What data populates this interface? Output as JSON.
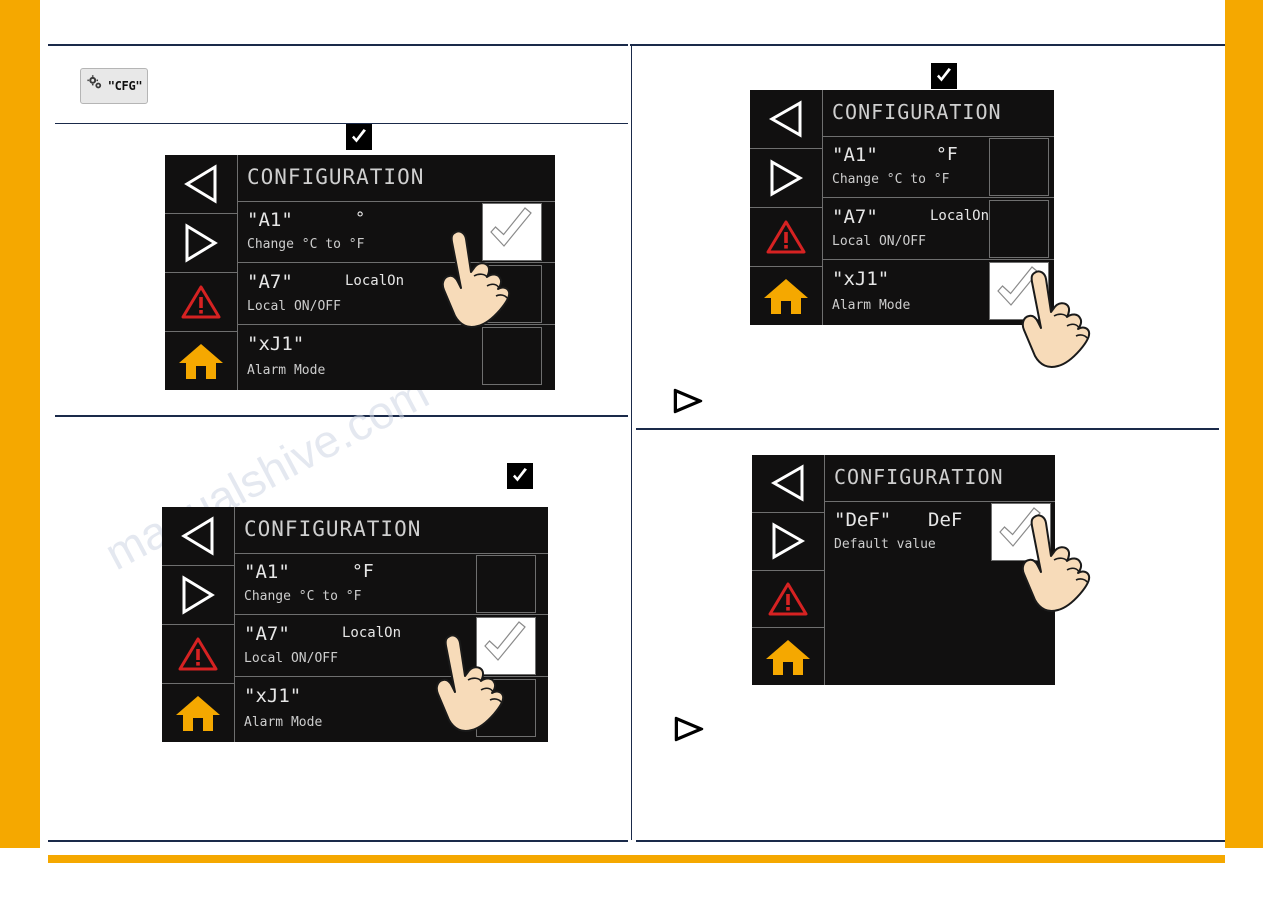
{
  "colors": {
    "accent_orange": "#f5a800",
    "rule_navy": "#1a2a4a",
    "screen_bg": "#111010",
    "screen_text": "#e6e6e6",
    "screen_grid": "#6f6f6f",
    "home_icon": "#f5a800",
    "warning_icon": "#d62222"
  },
  "cfg_button": {
    "label": "\"CFG\"",
    "icon": "gears-icon"
  },
  "watermark": {
    "text": "manualshive.com"
  },
  "panels": {
    "p1": {
      "title": "CONFIGURATION",
      "rows": [
        {
          "code": "\"A1\"",
          "value": "°",
          "desc": "Change °C to °F",
          "box": "checked"
        },
        {
          "code": "\"A7\"",
          "value": "LocalOn",
          "desc": "Local ON/OFF",
          "box": "empty"
        },
        {
          "code": "\"xJ1\"",
          "value": "",
          "desc": "Alarm Mode",
          "box": "empty"
        }
      ],
      "top_icon": "checkbox-checked-icon"
    },
    "p2": {
      "title": "CONFIGURATION",
      "rows": [
        {
          "code": "\"A1\"",
          "value": "°F",
          "desc": "Change °C to °F",
          "box": "empty"
        },
        {
          "code": "\"A7\"",
          "value": "LocalOn",
          "desc": "Local ON/OFF",
          "box": "checked"
        },
        {
          "code": "\"xJ1\"",
          "value": "",
          "desc": "Alarm Mode",
          "box": "empty"
        }
      ],
      "top_icon": "checkbox-checked-icon"
    },
    "p3": {
      "title": "CONFIGURATION",
      "rows": [
        {
          "code": "\"A1\"",
          "value": "°F",
          "desc": "Change °C to °F",
          "box": "empty"
        },
        {
          "code": "\"A7\"",
          "value": "LocalOn",
          "desc": "Local ON/OFF",
          "box": "empty"
        },
        {
          "code": "\"xJ1\"",
          "value": "",
          "desc": "Alarm Mode",
          "box": "checked"
        }
      ],
      "top_icon": "checkbox-checked-icon",
      "next_icon": "arrow-right-icon"
    },
    "p4": {
      "title": "CONFIGURATION",
      "rows": [
        {
          "code": "\"DeF\"",
          "value": "DeF",
          "desc": "Default value",
          "box": "checked"
        }
      ],
      "next_icon": "arrow-right-icon"
    }
  },
  "sidebar_icons": [
    "back-arrow-icon",
    "forward-arrow-icon",
    "warning-icon",
    "home-icon"
  ]
}
